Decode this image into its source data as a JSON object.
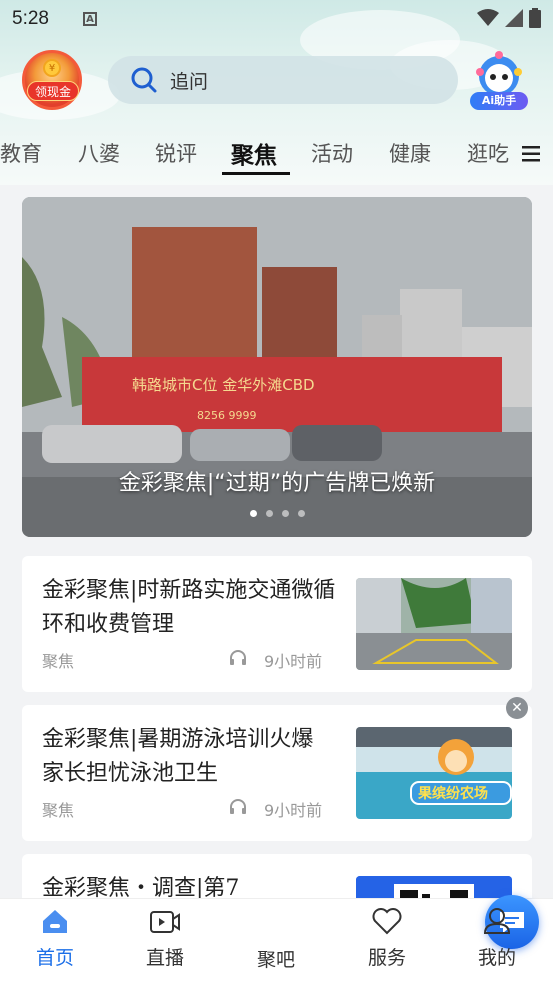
{
  "status_bar": {
    "time": "5:28",
    "notification_icon": "A"
  },
  "header": {
    "cash_label": "领现金",
    "coin_symbol": "¥",
    "search_placeholder": "追问",
    "ai_label": "Ai助手"
  },
  "tabs": [
    "教育",
    "八婆",
    "锐评",
    "聚焦",
    "活动",
    "健康",
    "逛吃"
  ],
  "active_tab": "聚焦",
  "banner": {
    "caption": "金彩聚焦|“过期”的广告牌已焕新",
    "sign_text": "韩路城市C位 金华外滩CBD",
    "sign_phone": "8256 9999",
    "dots": 4,
    "active_dot": 0
  },
  "articles": [
    {
      "title": "金彩聚焦|时新路实施交通微循环和收费管理",
      "source": "聚焦",
      "time": "9小时前"
    },
    {
      "title": "金彩聚焦|暑期游泳培训火爆 家长担忧泳池卫生",
      "source": "聚焦",
      "time": "9小时前",
      "overlay_text": "果缤纷农场"
    },
    {
      "title": "金彩聚焦・调查|第7",
      "source": "",
      "time": ""
    }
  ],
  "bottom_nav": {
    "home": "首页",
    "live": "直播",
    "forum": "聚吧",
    "services": "服务",
    "mine": "我的"
  },
  "colors": {
    "accent": "#1c6fe8",
    "header_bg": "#cfe9e6"
  }
}
